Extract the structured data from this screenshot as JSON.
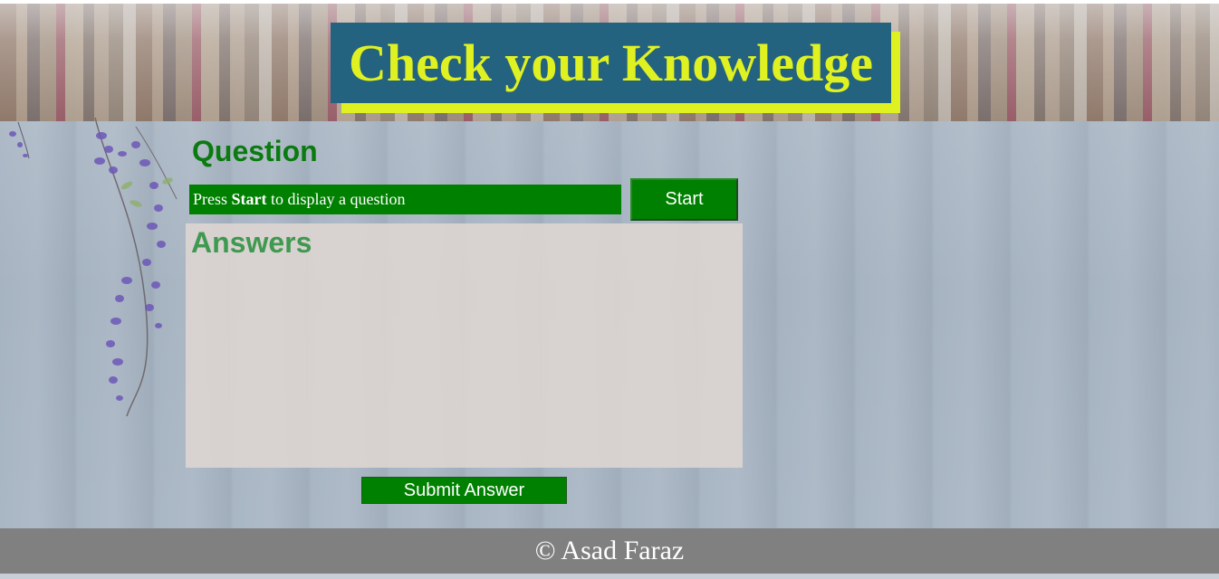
{
  "header": {
    "title": "Check your Knowledge"
  },
  "question": {
    "heading": "Question",
    "prompt_prefix": "Press ",
    "prompt_bold": "Start",
    "prompt_suffix": " to display a question",
    "start_label": "Start"
  },
  "answers": {
    "heading": "Answers",
    "items": []
  },
  "actions": {
    "submit_label": "Submit Answer"
  },
  "footer": {
    "text": "© Asad Faraz"
  },
  "colors": {
    "title_text": "#e0f121",
    "title_box": "#24637f",
    "primary_green": "#008000",
    "heading_green": "#0b7a10",
    "answers_heading": "#3f9950",
    "footer_bg": "#808080"
  },
  "icons": [
    "wisteria-vine-decoration",
    "bookshelf-banner"
  ]
}
